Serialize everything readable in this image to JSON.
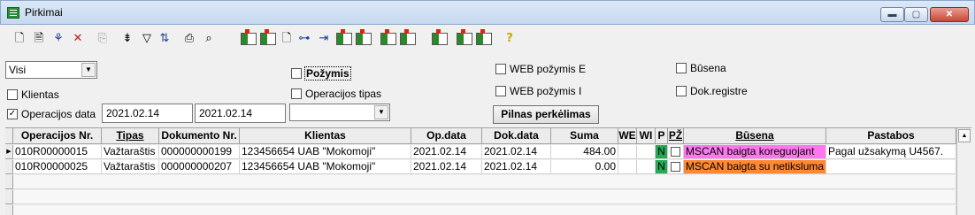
{
  "window": {
    "title": "Pirkimai",
    "minimize_icon": "minimize-icon",
    "maximize_icon": "maximize-icon",
    "close_icon": "close-icon",
    "minimize_glyph": "▬",
    "maximize_glyph": "▢",
    "close_glyph": "✕"
  },
  "toolbar": {
    "icons": [
      {
        "name": "new-document-icon",
        "glyph": "🗋"
      },
      {
        "name": "open-document-icon",
        "glyph": "🗎"
      },
      {
        "name": "tree-icon",
        "glyph": "⚘"
      },
      {
        "name": "delete-icon",
        "glyph": "✕"
      },
      {
        "name": "copy-icon",
        "glyph": "⎘"
      },
      {
        "name": "filter-tree-icon",
        "glyph": "⇟"
      },
      {
        "name": "filter-icon",
        "glyph": "▽"
      },
      {
        "name": "sort-az-icon",
        "glyph": "⇅"
      },
      {
        "name": "print-icon",
        "glyph": "⎙"
      },
      {
        "name": "find-icon",
        "glyph": "⌕"
      },
      {
        "name": "grid-action-1-icon",
        "glyph": ""
      },
      {
        "name": "grid-action-2-icon",
        "glyph": ""
      },
      {
        "name": "page-icon",
        "glyph": "🗋"
      },
      {
        "name": "hierarchy-icon",
        "glyph": "⊶"
      },
      {
        "name": "grid-arrow-icon",
        "glyph": "⇥"
      },
      {
        "name": "grid-action-3-icon",
        "glyph": ""
      },
      {
        "name": "grid-action-4-icon",
        "glyph": ""
      },
      {
        "name": "grid-action-5-icon",
        "glyph": ""
      },
      {
        "name": "grid-action-6-icon",
        "glyph": ""
      },
      {
        "name": "grid-action-7-icon",
        "glyph": ""
      },
      {
        "name": "grid-action-8-icon",
        "glyph": ""
      },
      {
        "name": "grid-action-9-icon",
        "glyph": ""
      },
      {
        "name": "help-icon",
        "glyph": "?"
      }
    ]
  },
  "filters": {
    "type_combo_value": "Visi",
    "combo_arrow": "▼",
    "klientas_label": "Klientas",
    "operacijos_data_label": "Operacijos data",
    "date_from": "2021.02.14",
    "date_to": "2021.02.14",
    "pozymis_label": "Požymis",
    "operacijos_tipas_label": "Operacijos tipas",
    "operacijos_tipas_value": "",
    "web_pozymis_e_label": "WEB požymis E",
    "web_pozymis_i_label": "WEB požymis I",
    "busena_label": "Būsena",
    "dok_registre_label": "Dok.registre",
    "pilnas_button": "Pilnas perkėlimas",
    "check_mark": "✓"
  },
  "table": {
    "headers": [
      "Operacijos Nr.",
      "Tipas",
      "Dokumento Nr.",
      "Klientas",
      "Op.data",
      "Dok.data",
      "Suma",
      "WE",
      "WI",
      "P",
      "PŽ",
      "Būsena",
      "Pastabos"
    ],
    "row_marker": "▶",
    "scroll_up": "▲",
    "rows": [
      {
        "op_nr": "010R00000015",
        "tipas": "Važtaraštis",
        "dok_nr": "000000000199",
        "klientas": "123456654 UAB \"Mokomoji\"",
        "op_data": "2021.02.14",
        "dok_data": "2021.02.14",
        "suma": "484.00",
        "we": "",
        "wi": "",
        "p": "N",
        "busena": "MSCAN baigta koreguojant",
        "pastabos": "Pagal užsakymą U4567.",
        "busena_color": "#ff77ee"
      },
      {
        "op_nr": "010R00000025",
        "tipas": "Važtaraštis",
        "dok_nr": "000000000207",
        "klientas": "123456654 UAB \"Mokomoji\"",
        "op_data": "2021.02.14",
        "dok_data": "2021.02.14",
        "suma": "0.00",
        "we": "",
        "wi": "",
        "p": "N",
        "busena": "MSCAN baigta su netiksluma",
        "pastabos": "",
        "busena_color": "#ff8833"
      }
    ]
  },
  "colors": {
    "p_cell": "#22aa55"
  }
}
